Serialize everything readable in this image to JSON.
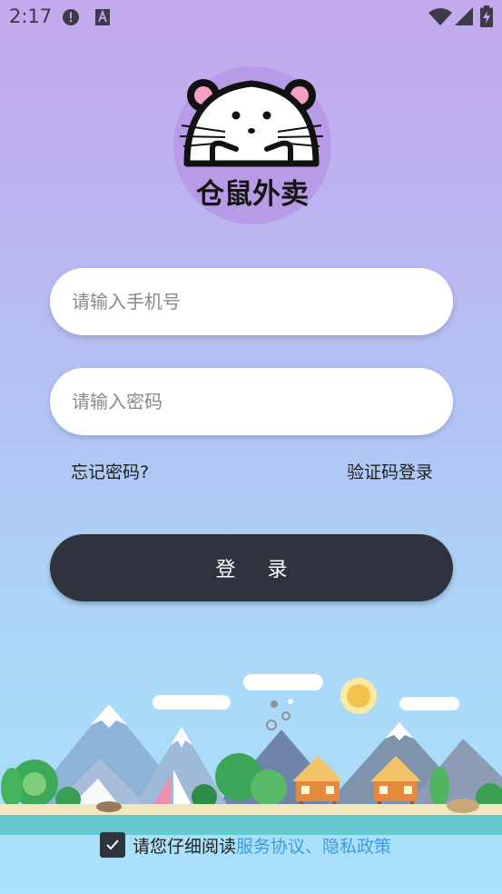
{
  "status_bar": {
    "time": "2:17"
  },
  "brand": {
    "name": "仓鼠外卖"
  },
  "form": {
    "phone_placeholder": "请输入手机号",
    "password_placeholder": "请输入密码",
    "forgot_password": "忘记密码?",
    "sms_login": "验证码登录",
    "login_button": "登 录"
  },
  "agreement": {
    "checked": true,
    "prefix": "请您仔细阅读",
    "terms": "服务协议",
    "separator": "、",
    "privacy": "隐私政策"
  },
  "colors": {
    "button": "#2e333d",
    "link": "#3e9be0",
    "logo_circle": "#b79be6",
    "gradient_top": "#c3a9ed",
    "gradient_bottom": "#a9e2fb"
  }
}
